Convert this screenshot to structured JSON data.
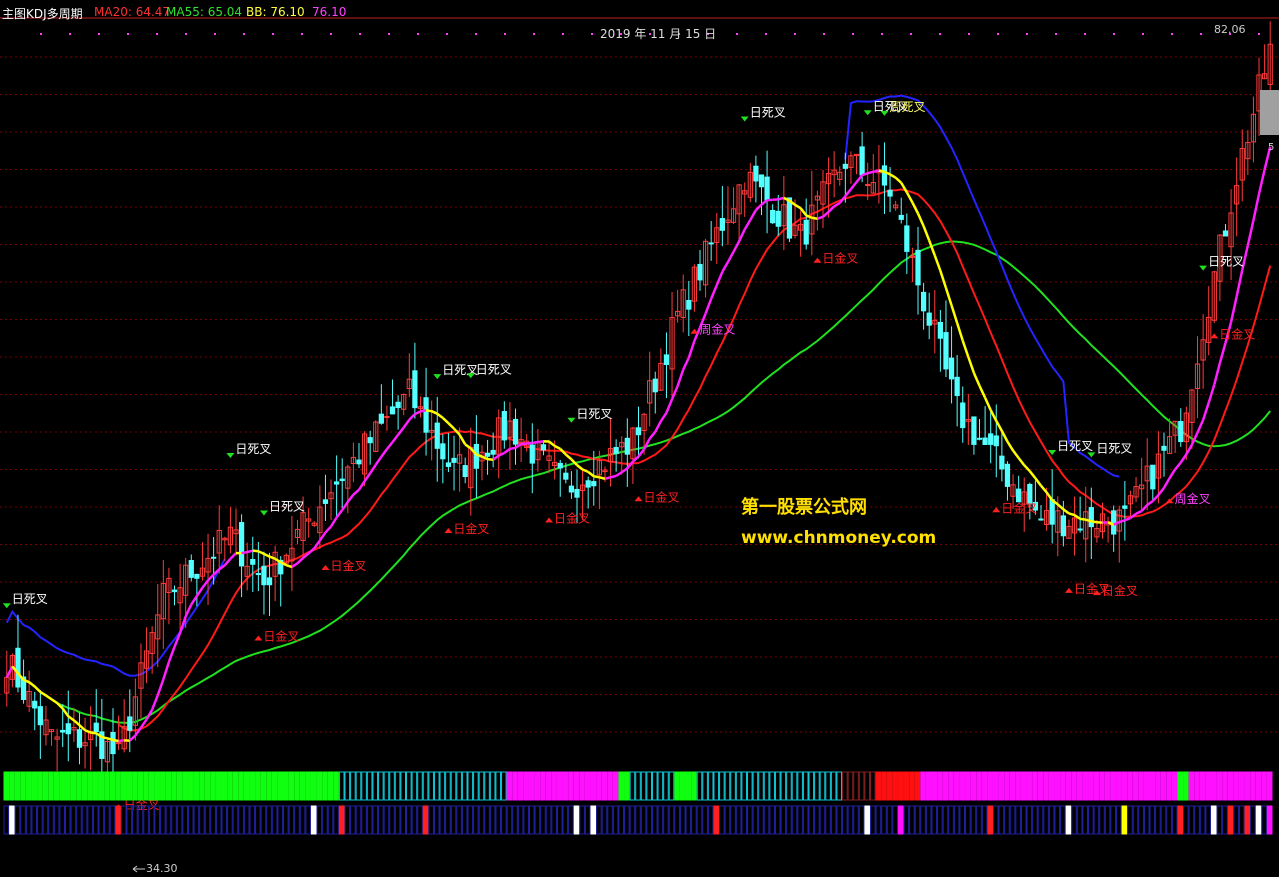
{
  "header": {
    "title": "主图KDJ多周期",
    "ma20": "MA20: 64.47",
    "ma55": "MA55: 65.04",
    "bb_label": "BB: 76.10",
    "bb_value": "76.10",
    "date": "2019 年 11 月 15 日"
  },
  "price_labels": {
    "high": "82.06",
    "low": "34.30",
    "partial": "5"
  },
  "watermark": {
    "name": "第一股票公式网",
    "url": "www.chnmoney.com"
  },
  "colors": {
    "background": "#000000",
    "grid": "#7a0000",
    "candle_up": "#ff3b3b",
    "candle_down": "#54ffff",
    "ma20": "#ff1a1a",
    "ma55": "#20e020",
    "bb": "#2424ff",
    "kdj_up": "#ff20ff",
    "kdj_down": "#ffff00",
    "cross_label": "#ffffff",
    "golden_label": "#ff2020",
    "week_dead_label": "#ffff60",
    "week_golden_label": "#ff40ff"
  },
  "chart_data": {
    "type": "candlestick",
    "title": "",
    "note": "daily candles with MA20, MA55, BB and multi-period KDJ signals",
    "y_range": [
      34.3,
      82.06
    ],
    "start_price": 40.0,
    "end_price": 80.0,
    "ma20_last": 64.47,
    "ma55_last": 65.04,
    "bb_last": 76.1,
    "signals": [
      {
        "text": "日死叉",
        "kind": "day_dead",
        "bar": 0
      },
      {
        "text": "日金叉",
        "kind": "day_golden",
        "bar": 20
      },
      {
        "text": "日死叉",
        "kind": "day_dead",
        "bar": 40
      },
      {
        "text": "日死叉",
        "kind": "day_dead",
        "bar": 46
      },
      {
        "text": "日金叉",
        "kind": "day_golden",
        "bar": 45
      },
      {
        "text": "日金叉",
        "kind": "day_golden",
        "bar": 57
      },
      {
        "text": "日死叉",
        "kind": "day_dead",
        "bar": 77
      },
      {
        "text": "日死叉",
        "kind": "day_dead",
        "bar": 83
      },
      {
        "text": "日金叉",
        "kind": "day_golden",
        "bar": 79
      },
      {
        "text": "日死叉",
        "kind": "day_dead",
        "bar": 101
      },
      {
        "text": "日金叉",
        "kind": "day_golden",
        "bar": 97
      },
      {
        "text": "日金叉",
        "kind": "day_golden",
        "bar": 113
      },
      {
        "text": "周金叉",
        "kind": "week_golden",
        "bar": 123
      },
      {
        "text": "日死叉",
        "kind": "day_dead",
        "bar": 132
      },
      {
        "text": "日金叉",
        "kind": "day_golden",
        "bar": 145
      },
      {
        "text": "日死叉",
        "kind": "day_dead",
        "bar": 154
      },
      {
        "text": "周死叉",
        "kind": "week_dead",
        "bar": 157
      },
      {
        "text": "日金叉",
        "kind": "day_golden",
        "bar": 177
      },
      {
        "text": "日死叉",
        "kind": "day_dead",
        "bar": 187
      },
      {
        "text": "日金叉",
        "kind": "day_golden",
        "bar": 190
      },
      {
        "text": "日死叉",
        "kind": "day_dead",
        "bar": 194
      },
      {
        "text": "日金叉",
        "kind": "day_golden",
        "bar": 195
      },
      {
        "text": "周金叉",
        "kind": "week_golden",
        "bar": 208
      },
      {
        "text": "日死叉",
        "kind": "day_dead",
        "bar": 214
      },
      {
        "text": "日金叉",
        "kind": "day_golden",
        "bar": 216
      }
    ]
  }
}
